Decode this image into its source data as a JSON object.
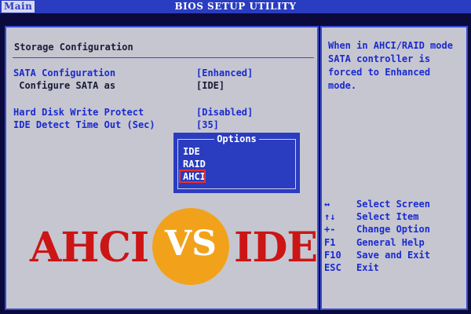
{
  "header": {
    "title": "BIOS SETUP UTILITY",
    "tab_main": "Main"
  },
  "left_panel": {
    "section_title": "Storage Configuration",
    "items": [
      {
        "label": "SATA Configuration",
        "value": "[Enhanced]"
      },
      {
        "label": " Configure SATA as",
        "value": "[IDE]"
      },
      {
        "label": "Hard Disk Write Protect",
        "value": "[Disabled]"
      },
      {
        "label": "IDE Detect Time Out (Sec)",
        "value": "[35]"
      }
    ]
  },
  "options_popup": {
    "title": "Options",
    "options": [
      "IDE",
      "RAID",
      "AHCI"
    ],
    "highlighted": "AHCI"
  },
  "right_panel": {
    "help_lines": [
      "When in AHCI/RAID mode",
      "SATA controller is",
      "forced to Enhanced",
      "mode."
    ],
    "keys": [
      {
        "key": "↔",
        "action": "Select Screen"
      },
      {
        "key": "↑↓",
        "action": "Select Item"
      },
      {
        "key": "+-",
        "action": "Change Option"
      },
      {
        "key": "F1",
        "action": "General Help"
      },
      {
        "key": "F10",
        "action": "Save and Exit"
      },
      {
        "key": "ESC",
        "action": "Exit"
      }
    ]
  },
  "overlay": {
    "left_word": "AHCI",
    "middle_word": "VS",
    "right_word": "IDE"
  },
  "colors": {
    "background": "#0a0a3c",
    "bios_blue": "#2a3cc0",
    "panel_gray": "#c6c6d0",
    "overlay_red": "#cc1515",
    "circle_orange": "#f2a21a",
    "highlight_box": "#e53030"
  }
}
